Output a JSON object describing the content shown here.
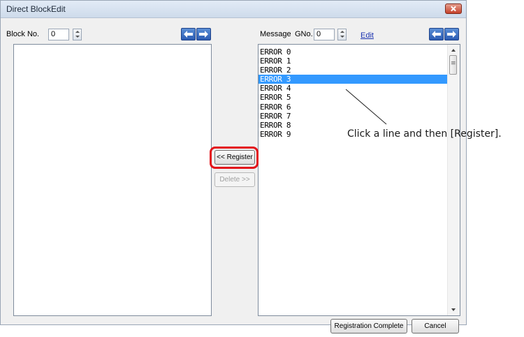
{
  "window": {
    "title": "Direct BlockEdit"
  },
  "left_panel": {
    "block_label": "Block No.",
    "block_value": "0"
  },
  "right_panel": {
    "message_label": "Message",
    "gno_label": "GNo.",
    "gno_value": "0",
    "edit_link": "Edit",
    "items": [
      "ERROR 0",
      "ERROR 1",
      "ERROR 2",
      "ERROR 3",
      "ERROR 4",
      "ERROR 5",
      "ERROR 6",
      "ERROR 7",
      "ERROR 8",
      "ERROR 9"
    ],
    "selected_index": 3
  },
  "buttons": {
    "register": "<< Register",
    "delete": "Delete >>",
    "registration_complete": "Registration Complete",
    "cancel": "Cancel"
  },
  "annotation": {
    "text": "Click a line and then [Register]."
  },
  "colors": {
    "selection": "#3399ff",
    "highlight": "#e3141b",
    "arrow_button": "#2c5cb3"
  },
  "icons": [
    "close-icon",
    "spin-up-icon",
    "spin-down-icon",
    "arrow-left-icon",
    "arrow-right-icon",
    "scroll-up-icon",
    "scroll-down-icon"
  ]
}
